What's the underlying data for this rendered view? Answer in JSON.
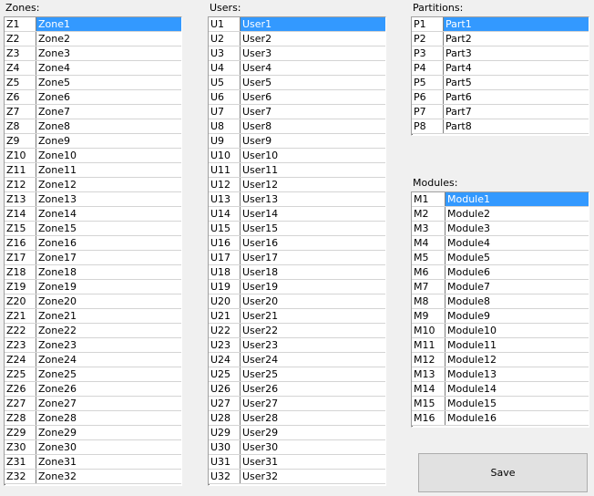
{
  "zones": {
    "label": "Zones:",
    "rows": [
      {
        "id": "Z1",
        "name": "Zone1",
        "selected": true
      },
      {
        "id": "Z2",
        "name": "Zone2"
      },
      {
        "id": "Z3",
        "name": "Zone3"
      },
      {
        "id": "Z4",
        "name": "Zone4"
      },
      {
        "id": "Z5",
        "name": "Zone5"
      },
      {
        "id": "Z6",
        "name": "Zone6"
      },
      {
        "id": "Z7",
        "name": "Zone7"
      },
      {
        "id": "Z8",
        "name": "Zone8"
      },
      {
        "id": "Z9",
        "name": "Zone9"
      },
      {
        "id": "Z10",
        "name": "Zone10"
      },
      {
        "id": "Z11",
        "name": "Zone11"
      },
      {
        "id": "Z12",
        "name": "Zone12"
      },
      {
        "id": "Z13",
        "name": "Zone13"
      },
      {
        "id": "Z14",
        "name": "Zone14"
      },
      {
        "id": "Z15",
        "name": "Zone15"
      },
      {
        "id": "Z16",
        "name": "Zone16"
      },
      {
        "id": "Z17",
        "name": "Zone17"
      },
      {
        "id": "Z18",
        "name": "Zone18"
      },
      {
        "id": "Z19",
        "name": "Zone19"
      },
      {
        "id": "Z20",
        "name": "Zone20"
      },
      {
        "id": "Z21",
        "name": "Zone21"
      },
      {
        "id": "Z22",
        "name": "Zone22"
      },
      {
        "id": "Z23",
        "name": "Zone23"
      },
      {
        "id": "Z24",
        "name": "Zone24"
      },
      {
        "id": "Z25",
        "name": "Zone25"
      },
      {
        "id": "Z26",
        "name": "Zone26"
      },
      {
        "id": "Z27",
        "name": "Zone27"
      },
      {
        "id": "Z28",
        "name": "Zone28"
      },
      {
        "id": "Z29",
        "name": "Zone29"
      },
      {
        "id": "Z30",
        "name": "Zone30"
      },
      {
        "id": "Z31",
        "name": "Zone31"
      },
      {
        "id": "Z32",
        "name": "Zone32"
      }
    ]
  },
  "users": {
    "label": "Users:",
    "rows": [
      {
        "id": "U1",
        "name": "User1",
        "selected": true
      },
      {
        "id": "U2",
        "name": "User2"
      },
      {
        "id": "U3",
        "name": "User3"
      },
      {
        "id": "U4",
        "name": "User4"
      },
      {
        "id": "U5",
        "name": "User5"
      },
      {
        "id": "U6",
        "name": "User6"
      },
      {
        "id": "U7",
        "name": "User7"
      },
      {
        "id": "U8",
        "name": "User8"
      },
      {
        "id": "U9",
        "name": "User9"
      },
      {
        "id": "U10",
        "name": "User10"
      },
      {
        "id": "U11",
        "name": "User11"
      },
      {
        "id": "U12",
        "name": "User12"
      },
      {
        "id": "U13",
        "name": "User13"
      },
      {
        "id": "U14",
        "name": "User14"
      },
      {
        "id": "U15",
        "name": "User15"
      },
      {
        "id": "U16",
        "name": "User16"
      },
      {
        "id": "U17",
        "name": "User17"
      },
      {
        "id": "U18",
        "name": "User18"
      },
      {
        "id": "U19",
        "name": "User19"
      },
      {
        "id": "U20",
        "name": "User20"
      },
      {
        "id": "U21",
        "name": "User21"
      },
      {
        "id": "U22",
        "name": "User22"
      },
      {
        "id": "U23",
        "name": "User23"
      },
      {
        "id": "U24",
        "name": "User24"
      },
      {
        "id": "U25",
        "name": "User25"
      },
      {
        "id": "U26",
        "name": "User26"
      },
      {
        "id": "U27",
        "name": "User27"
      },
      {
        "id": "U28",
        "name": "User28"
      },
      {
        "id": "U29",
        "name": "User29"
      },
      {
        "id": "U30",
        "name": "User30"
      },
      {
        "id": "U31",
        "name": "User31"
      },
      {
        "id": "U32",
        "name": "User32"
      }
    ]
  },
  "partitions": {
    "label": "Partitions:",
    "rows": [
      {
        "id": "P1",
        "name": "Part1",
        "selected": true
      },
      {
        "id": "P2",
        "name": "Part2"
      },
      {
        "id": "P3",
        "name": "Part3"
      },
      {
        "id": "P4",
        "name": "Part4"
      },
      {
        "id": "P5",
        "name": "Part5"
      },
      {
        "id": "P6",
        "name": "Part6"
      },
      {
        "id": "P7",
        "name": "Part7"
      },
      {
        "id": "P8",
        "name": "Part8"
      }
    ]
  },
  "modules": {
    "label": "Modules:",
    "rows": [
      {
        "id": "M1",
        "name": "Module1",
        "selected": true
      },
      {
        "id": "M2",
        "name": "Module2"
      },
      {
        "id": "M3",
        "name": "Module3"
      },
      {
        "id": "M4",
        "name": "Module4"
      },
      {
        "id": "M5",
        "name": "Module5"
      },
      {
        "id": "M6",
        "name": "Module6"
      },
      {
        "id": "M7",
        "name": "Module7"
      },
      {
        "id": "M8",
        "name": "Module8"
      },
      {
        "id": "M9",
        "name": "Module9"
      },
      {
        "id": "M10",
        "name": "Module10"
      },
      {
        "id": "M11",
        "name": "Module11"
      },
      {
        "id": "M12",
        "name": "Module12"
      },
      {
        "id": "M13",
        "name": "Module13"
      },
      {
        "id": "M14",
        "name": "Module14"
      },
      {
        "id": "M15",
        "name": "Module15"
      },
      {
        "id": "M16",
        "name": "Module16"
      }
    ]
  },
  "save_label": "Save",
  "colors": {
    "selection": "#3399ff",
    "window": "#f0f0f0"
  }
}
